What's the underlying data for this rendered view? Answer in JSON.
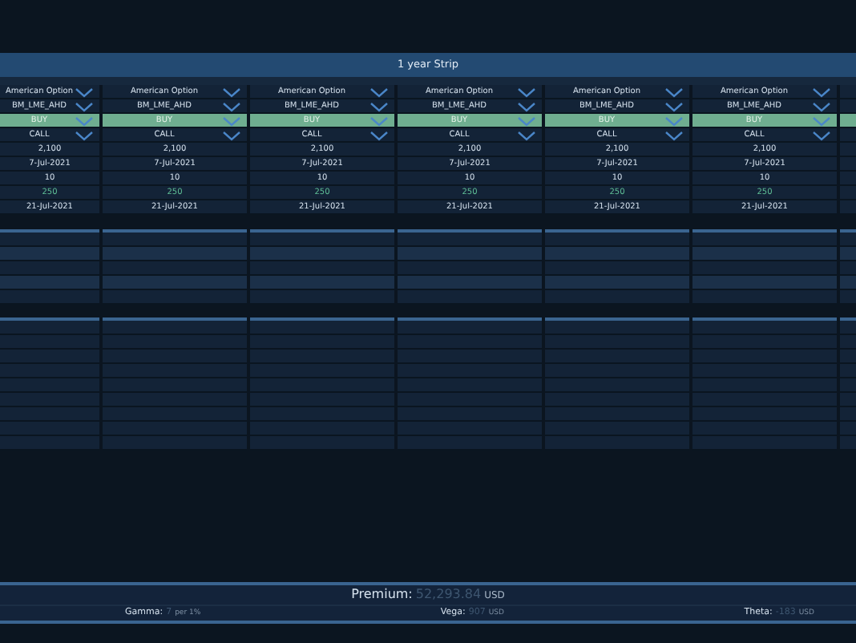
{
  "strip": {
    "title": "1 year Strip"
  },
  "legs": [
    [
      {
        "text": "American Option",
        "kind": "select"
      },
      {
        "text": "BM_LME_AHD",
        "kind": "select"
      },
      {
        "text": "BUY",
        "kind": "action"
      },
      {
        "text": "CALL",
        "kind": "select"
      },
      {
        "text": "2,100",
        "kind": "value"
      },
      {
        "text": "7-Jul-2021",
        "kind": "value"
      },
      {
        "text": "10",
        "kind": "value"
      },
      {
        "text": "250",
        "kind": "accent"
      },
      {
        "text": "21-Jul-2021",
        "kind": "value"
      }
    ],
    [
      {
        "text": "American Option",
        "kind": "select"
      },
      {
        "text": "BM_LME_AHD",
        "kind": "select"
      },
      {
        "text": "BUY",
        "kind": "action"
      },
      {
        "text": "CALL",
        "kind": "select"
      },
      {
        "text": "2,100",
        "kind": "value"
      },
      {
        "text": "7-Jul-2021",
        "kind": "value"
      },
      {
        "text": "10",
        "kind": "value"
      },
      {
        "text": "250",
        "kind": "accent"
      },
      {
        "text": "21-Jul-2021",
        "kind": "value"
      }
    ],
    [
      {
        "text": "American Option",
        "kind": "select"
      },
      {
        "text": "BM_LME_AHD",
        "kind": "select"
      },
      {
        "text": "BUY",
        "kind": "action"
      },
      {
        "text": "CALL",
        "kind": "select"
      },
      {
        "text": "2,100",
        "kind": "value"
      },
      {
        "text": "7-Jul-2021",
        "kind": "value"
      },
      {
        "text": "10",
        "kind": "value"
      },
      {
        "text": "250",
        "kind": "accent"
      },
      {
        "text": "21-Jul-2021",
        "kind": "value"
      }
    ],
    [
      {
        "text": "American Option",
        "kind": "select"
      },
      {
        "text": "BM_LME_AHD",
        "kind": "select"
      },
      {
        "text": "BUY",
        "kind": "action"
      },
      {
        "text": "CALL",
        "kind": "select"
      },
      {
        "text": "2,100",
        "kind": "value"
      },
      {
        "text": "7-Jul-2021",
        "kind": "value"
      },
      {
        "text": "10",
        "kind": "value"
      },
      {
        "text": "250",
        "kind": "accent"
      },
      {
        "text": "21-Jul-2021",
        "kind": "value"
      }
    ],
    [
      {
        "text": "American Option",
        "kind": "select"
      },
      {
        "text": "BM_LME_AHD",
        "kind": "select"
      },
      {
        "text": "BUY",
        "kind": "action"
      },
      {
        "text": "CALL",
        "kind": "select"
      },
      {
        "text": "2,100",
        "kind": "value"
      },
      {
        "text": "7-Jul-2021",
        "kind": "value"
      },
      {
        "text": "10",
        "kind": "value"
      },
      {
        "text": "250",
        "kind": "accent"
      },
      {
        "text": "21-Jul-2021",
        "kind": "value"
      }
    ],
    [
      {
        "text": "American Option",
        "kind": "select"
      },
      {
        "text": "BM_LME_AHD",
        "kind": "select"
      },
      {
        "text": "BUY",
        "kind": "action"
      },
      {
        "text": "CALL",
        "kind": "select"
      },
      {
        "text": "2,100",
        "kind": "value"
      },
      {
        "text": "7-Jul-2021",
        "kind": "value"
      },
      {
        "text": "10",
        "kind": "value"
      },
      {
        "text": "250",
        "kind": "accent"
      },
      {
        "text": "21-Jul-2021",
        "kind": "value"
      }
    ]
  ],
  "summary": {
    "premium": {
      "label": "Premium:",
      "value": "52,293.84",
      "unit": "USD"
    },
    "greeks": [
      {
        "label": "Gamma:",
        "value": "7",
        "unit": "per 1%"
      },
      {
        "label": "Vega:",
        "value": "907",
        "unit": "USD"
      },
      {
        "label": "Theta:",
        "value": "-183",
        "unit": "USD"
      }
    ]
  }
}
